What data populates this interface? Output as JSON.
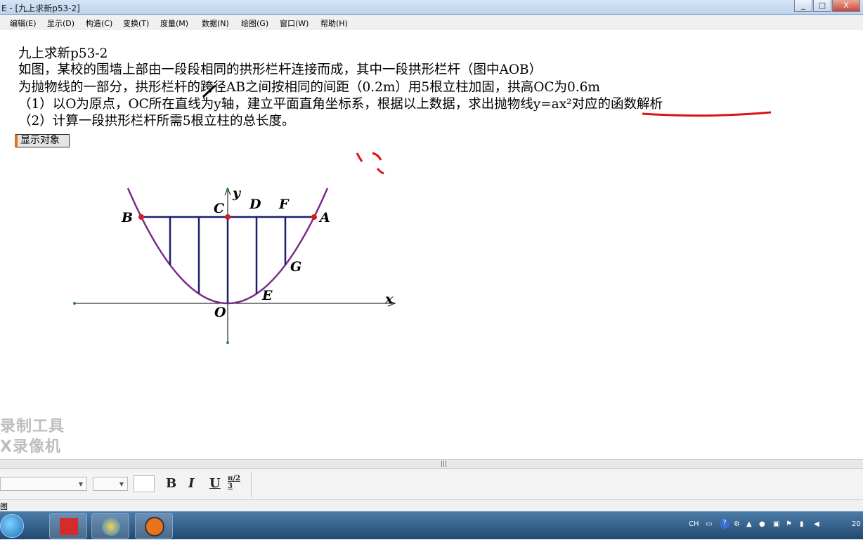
{
  "window": {
    "title": "E - [九上求新p53-2]",
    "controls": [
      "_",
      "□",
      "X"
    ]
  },
  "menu": [
    "编辑(E)",
    "显示(D)",
    "构造(C)",
    "变换(T)",
    "度量(M)",
    "数据(N)",
    "绘图(G)",
    "窗口(W)",
    "帮助(H)"
  ],
  "problem": {
    "line1": "九上求新p53-2",
    "line2": "如图，某校的围墙上部由一段段相同的拱形栏杆连接而成，其中一段拱形栏杆（图中AOB）",
    "line3": "为抛物线的一部分，拱形栏杆的跨径AB之间按相同的间距（0.2m）用5根立柱加固，拱高OC为0.6m",
    "line4": "（1）以O为原点，OC所在直线为y轴，建立平面直角坐标系，根据以上数据，求出抛物线y=ax²对应的函数解析",
    "line5": "（2）计算一段拱形栏杆所需5根立柱的总长度。"
  },
  "show_button": "显示对象",
  "graph_labels": {
    "A": "A",
    "B": "B",
    "C": "C",
    "D": "D",
    "E": "E",
    "F": "F",
    "G": "G",
    "O": "O",
    "x": "x",
    "y": "y"
  },
  "watermark": {
    "line1": "录制工具",
    "line2": "X录像机"
  },
  "toolbar": {
    "bold": "B",
    "italic": "I",
    "underline": "U",
    "math": "π/2 3"
  },
  "status": "图",
  "tray": {
    "lang": "CH",
    "clock": "20"
  },
  "colors": {
    "parabola": "#7a2a8a",
    "posts": "#1a1f6e",
    "points": "#cc2222",
    "annotation": "#dd1111"
  }
}
